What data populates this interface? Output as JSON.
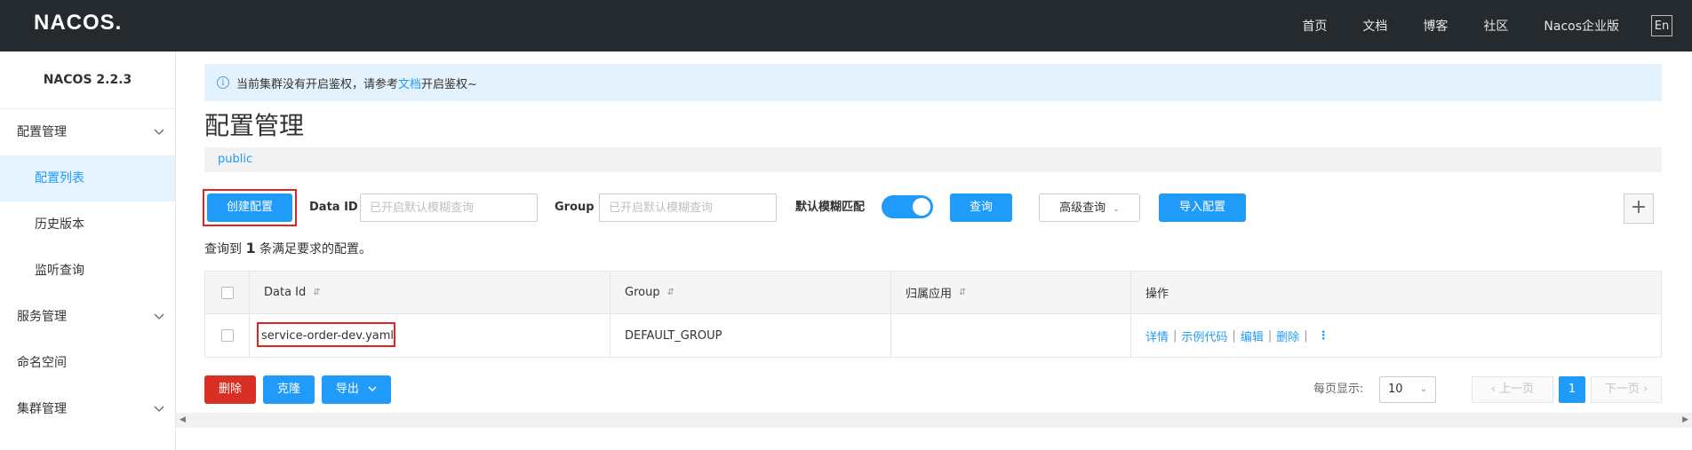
{
  "header": {
    "logo": "NACOS.",
    "nav": [
      "首页",
      "文档",
      "博客",
      "社区",
      "Nacos企业版"
    ],
    "lang_button": "En"
  },
  "sidebar": {
    "version": "NACOS 2.2.3",
    "groups": {
      "config": "配置管理",
      "service": "服务管理",
      "namespace": "命名空间",
      "cluster": "集群管理"
    },
    "config_items": [
      "配置列表",
      "历史版本",
      "监听查询"
    ],
    "active_item": "配置列表"
  },
  "notice": {
    "prefix": "当前集群没有开启鉴权，请参考",
    "link": "文档",
    "suffix": "开启鉴权~"
  },
  "page_title": "配置管理",
  "namespace": "public",
  "toolbar": {
    "create_label": "创建配置",
    "data_id_label": "Data ID",
    "data_id_placeholder": "已开启默认模糊查询",
    "group_label": "Group",
    "group_placeholder": "已开启默认模糊查询",
    "fuzzy_label": "默认模糊匹配",
    "fuzzy_on": true,
    "query_label": "查询",
    "advanced_label": "高级查询",
    "import_label": "导入配置",
    "plus": "+"
  },
  "result": {
    "prefix": "查询到",
    "count": "1",
    "suffix": "条满足要求的配置。"
  },
  "table": {
    "headers": [
      "Data Id",
      "Group",
      "归属应用",
      "操作"
    ],
    "rows": [
      {
        "data_id": "service-order-dev.yaml",
        "group": "DEFAULT_GROUP",
        "app": "",
        "ops": [
          "详情",
          "示例代码",
          "编辑",
          "删除"
        ]
      }
    ]
  },
  "bottom": {
    "delete_label": "删除",
    "clone_label": "克隆",
    "export_label": "导出",
    "page_size_label": "每页显示:",
    "page_size": "10",
    "prev_label": "上一页",
    "current_page": "1",
    "next_label": "下一页"
  },
  "colors": {
    "primary": "#209bfa",
    "danger": "#d93026",
    "header_bg": "#252a2f",
    "highlight_box": "#e02222"
  }
}
